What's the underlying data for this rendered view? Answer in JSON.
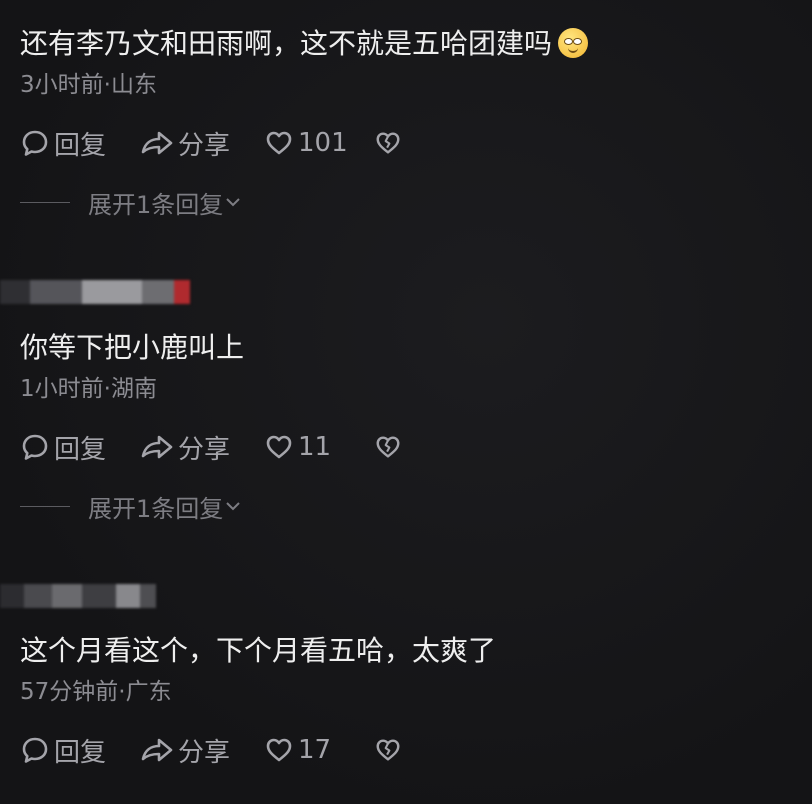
{
  "comments": [
    {
      "text": "还有李乃文和田雨啊，这不就是五哈团建吗",
      "emoji": "smiling-face-icon",
      "meta": "3小时前·山东",
      "reply_label": "回复",
      "share_label": "分享",
      "likes": "101",
      "expand_label": "展开1条回复"
    },
    {
      "text": "你等下把小鹿叫上",
      "meta": "1小时前·湖南",
      "reply_label": "回复",
      "share_label": "分享",
      "likes": "11",
      "expand_label": "展开1条回复"
    },
    {
      "text": "这个月看这个，下个月看五哈，太爽了",
      "meta": "57分钟前·广东",
      "reply_label": "回复",
      "share_label": "分享",
      "likes": "17"
    }
  ],
  "colors": {
    "background": "#161618",
    "text": "#eeeeee",
    "meta": "#8c8c92",
    "action": "#a4a4aa"
  }
}
